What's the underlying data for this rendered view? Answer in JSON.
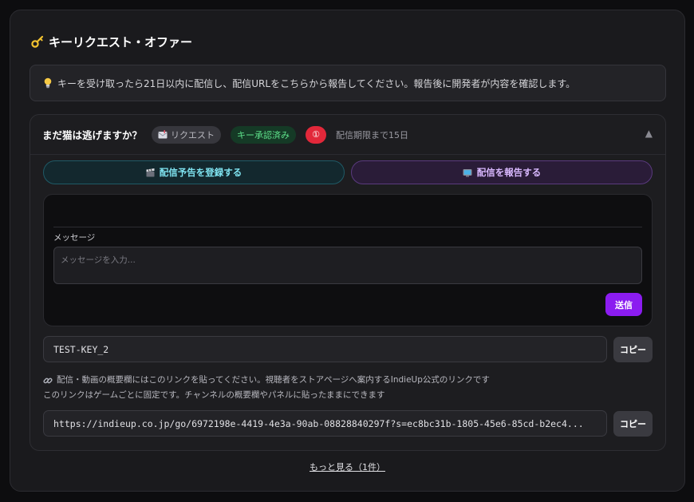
{
  "panel": {
    "title": "キーリクエスト・オファー",
    "title_icon": "key-icon"
  },
  "info": {
    "icon": "lightbulb-icon",
    "text": "キーを受け取ったら21日以内に配信し、配信URLをこちらから報告してください。報告後に開発者が内容を確認します。"
  },
  "card": {
    "game_title": "まだ猫は逃げますか？",
    "request_badge": "リクエスト",
    "request_icon": "mailbox-icon",
    "approved_badge": "キー承認済み",
    "count_badge": "①",
    "deadline": "配信期限まで15日",
    "collapse_icon": "▲",
    "schedule_button": "配信予告を登録する",
    "schedule_icon": "clapper-icon",
    "report_button": "配信を報告する",
    "report_icon": "tv-icon",
    "message": {
      "label": "メッセージ",
      "placeholder": "メッセージを入力...",
      "send_label": "送信"
    },
    "key_value": "TEST-KEY_2",
    "copy_label": "コピー",
    "link_note_line1": "配信・動画の概要欄にはこのリンクを貼ってください。視聴者をストアページへ案内するIndieUp公式のリンクです",
    "link_note_line2": "このリンクはゲームごとに固定です。チャンネルの概要欄やパネルに貼ったままにできます",
    "link_icon": "link-icon",
    "url_value": "https://indieup.co.jp/go/6972198e-4419-4e3a-90ab-08828840297f?s=ec8bc31b-1805-45e6-85cd-b2ec4..."
  },
  "more_link": "もっと見る（1件）",
  "colors": {
    "accent_purple": "#8b1cf0",
    "approved_green": "#5ee08a",
    "count_red": "#e2283a",
    "schedule_cyan": "#7fe3f0"
  }
}
